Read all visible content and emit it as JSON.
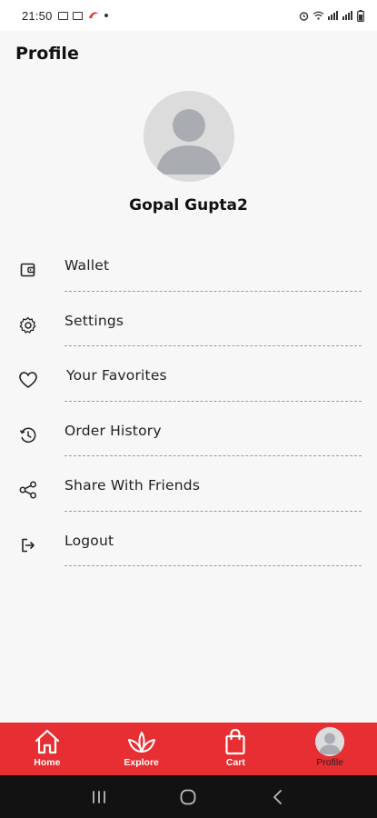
{
  "status_bar": {
    "time": "21:50"
  },
  "header": {
    "title": "Profile"
  },
  "user": {
    "name": "Gopal Gupta2"
  },
  "menu": {
    "items": [
      {
        "label": "Wallet",
        "icon": "wallet-icon"
      },
      {
        "label": "Settings",
        "icon": "gear-icon"
      },
      {
        "label": "Your Favorites",
        "icon": "heart-icon"
      },
      {
        "label": "Order History",
        "icon": "history-icon"
      },
      {
        "label": "Share With Friends",
        "icon": "share-icon"
      },
      {
        "label": "Logout",
        "icon": "logout-icon"
      }
    ]
  },
  "bottom_nav": {
    "items": [
      {
        "label": "Home",
        "icon": "home-icon"
      },
      {
        "label": "Explore",
        "icon": "leaf-icon"
      },
      {
        "label": "Cart",
        "icon": "shopping-bag-icon"
      },
      {
        "label": "Profile",
        "icon": "avatar-icon",
        "active": true
      }
    ]
  },
  "colors": {
    "accent": "#e62e33",
    "background": "#f7f7f7",
    "divider": "#9a9a9a"
  }
}
